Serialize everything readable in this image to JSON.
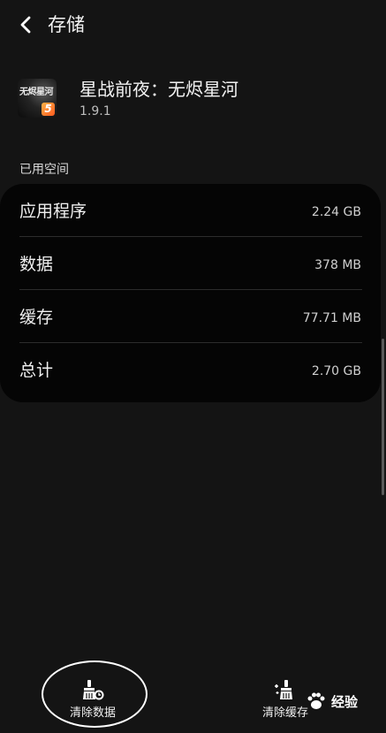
{
  "header": {
    "title": "存储"
  },
  "app": {
    "name": "星战前夜：无烬星河",
    "version": "1.9.1",
    "icon_text": "无烬星河",
    "icon_badge": "5"
  },
  "storage": {
    "section_label": "已用空间",
    "rows": [
      {
        "label": "应用程序",
        "value": "2.24 GB"
      },
      {
        "label": "数据",
        "value": "378 MB"
      },
      {
        "label": "缓存",
        "value": "77.71 MB"
      },
      {
        "label": "总计",
        "value": "2.70 GB"
      }
    ]
  },
  "actions": {
    "clear_data_label": "清除数据",
    "clear_cache_label": "清除缓存"
  },
  "watermark": {
    "text": "经验"
  },
  "icons": {
    "back": "chevron-left-icon",
    "clear_data": "broom-data-icon",
    "clear_cache": "brush-sparkle-icon"
  },
  "colors": {
    "background": "#141414",
    "card": "#050505",
    "text": "#f0f0f0"
  }
}
